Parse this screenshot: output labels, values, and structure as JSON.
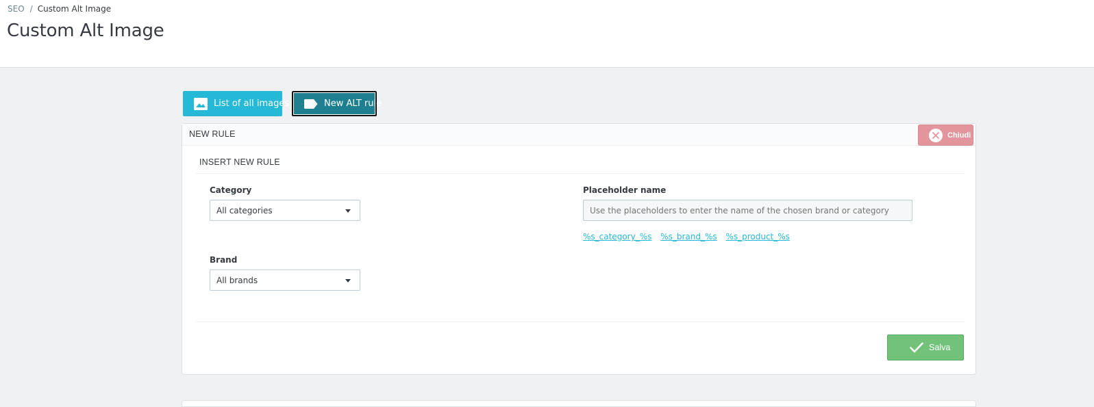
{
  "breadcrumb": {
    "parent": "SEO",
    "separator": "/",
    "current": "Custom Alt Image"
  },
  "page": {
    "title": "Custom Alt Image"
  },
  "toolbar": {
    "list_label": "List of all images",
    "list_icon": "image-icon",
    "new_label": "New ALT rule",
    "new_icon": "label-tag-icon"
  },
  "panel": {
    "title": "NEW RULE",
    "close_label": "Chiudi",
    "close_icon": "close-icon",
    "section_title": "INSERT NEW RULE"
  },
  "form": {
    "category_label": "Category",
    "category_value": "All categories",
    "brand_label": "Brand",
    "brand_value": "All brands",
    "placeholder_label": "Placeholder name",
    "placeholder_text": "Use the placeholders to enter the name of the chosen brand or category",
    "placeholder_tokens": [
      "%s_category_%s",
      "%s_brand_%s",
      "%s_product_%s"
    ]
  },
  "actions": {
    "save_label": "Salva",
    "save_icon": "check-icon"
  },
  "colors": {
    "primary": "#25b9d7",
    "active_tab": "#1e7f91",
    "danger": "#e2959d",
    "success": "#72c279"
  }
}
